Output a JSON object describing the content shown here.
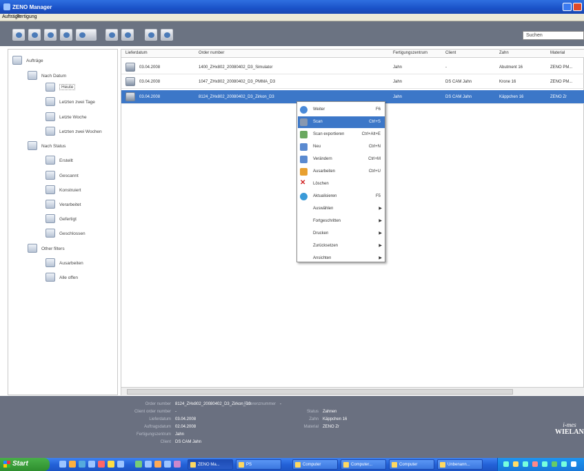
{
  "window": {
    "title": "ZENO Manager"
  },
  "menu": {
    "tab1": "Aufträge",
    "tab2": "Fertigung"
  },
  "toolbar": {
    "search_value": "Suchen"
  },
  "sidebar": {
    "root": "Aufträge",
    "nach_datum": "Nach Datum",
    "heute": "Heute",
    "letzten_zwei_tage": "Letzten zwei Tage",
    "letzte_woche": "Letzte Woche",
    "letzten_zwei_wochen": "Letzten zwei Wochen",
    "nach_status": "Nach Status",
    "erstellt": "Erstellt",
    "gescannt": "Gescannt",
    "konstruiert": "Konstruiert",
    "verarbeitet": "Verarbeitet",
    "gefertigt": "Gefertigt",
    "geschlossen": "Geschlossen",
    "other_filters": "Other filters",
    "ausarbeiten": "Ausarbeiten",
    "alle_offen": "Alle offen"
  },
  "table": {
    "columns": [
      "Lieferdatum",
      "Order number",
      "Fertigungszentrum",
      "Client",
      "Zahn",
      "Material"
    ],
    "rows": [
      {
        "date": "03.04.2008",
        "order": "1400_ZHx802_20080402_D3_Simulator",
        "center": "Jahn",
        "client": "-",
        "zahn": "Abutment 16",
        "material": "ZENO PM..."
      },
      {
        "date": "03.04.2008",
        "order": "1047_ZHx802_20080402_D3_PMMA_D3",
        "center": "Jahn",
        "client": "DS CAM Jahn",
        "zahn": "Krone 16",
        "material": "ZENO PM..."
      },
      {
        "date": "03.04.2008",
        "order": "8124_ZHx802_20080402_D3_Zirkon_D3",
        "center": "Jahn",
        "client": "DS CAM Jahn",
        "zahn": "Käppchen 16",
        "material": "ZENO Zr"
      }
    ]
  },
  "context_menu": {
    "items": [
      {
        "label": "Weiter",
        "shortcut": "F6"
      },
      {
        "label": "Scan",
        "shortcut": "Ctrl+S"
      },
      {
        "label": "Scan exportieren",
        "shortcut": "Ctrl+Alt+E"
      },
      {
        "label": "Neu",
        "shortcut": "Ctrl+N"
      },
      {
        "label": "Verändern",
        "shortcut": "Ctrl+M"
      },
      {
        "label": "Ausarbeiten",
        "shortcut": "Ctrl+U"
      },
      {
        "label": "Löschen",
        "shortcut": ""
      },
      {
        "label": "Aktualisieren",
        "shortcut": "F5"
      },
      {
        "label": "Auswählen",
        "shortcut": ""
      },
      {
        "label": "Fortgeschritten",
        "shortcut": ""
      },
      {
        "label": "Drucken",
        "shortcut": ""
      },
      {
        "label": "Zurücksetzen",
        "shortcut": ""
      },
      {
        "label": "Ansichten",
        "shortcut": ""
      }
    ]
  },
  "details": {
    "order_label": "Order number",
    "order_value": "8124_ZHx802_20080402_D3_Zirkon_D3",
    "client_order_label": "Client order number",
    "client_order_value": "-",
    "ref_label": "Referenznummer",
    "ref_value": "-",
    "lieferdatum_label": "Lieferdatum",
    "lieferdatum_value": "03.04.2008",
    "auftragsdatum_label": "Auftragsdatum",
    "auftragsdatum_value": "02.04.2008",
    "zentrum_label": "Fertigungszentrum",
    "zentrum_value": "Jahn",
    "client_label": "Client",
    "client_value": "DS CAM Jahn",
    "status_label": "Status",
    "status_value": "Zahnen",
    "typ_label": "Zahn",
    "typ_value": "Käppchen 16",
    "material_label": "Material",
    "material_value": "ZENO Zr"
  },
  "brand": {
    "line1": "i-mes",
    "line2": "WIELAND"
  },
  "taskbar": {
    "start": "Start",
    "tasks": [
      "ZENO Ma...",
      "PS",
      "Computer",
      "Computer...",
      "Computer",
      "Unbenann..."
    ]
  }
}
